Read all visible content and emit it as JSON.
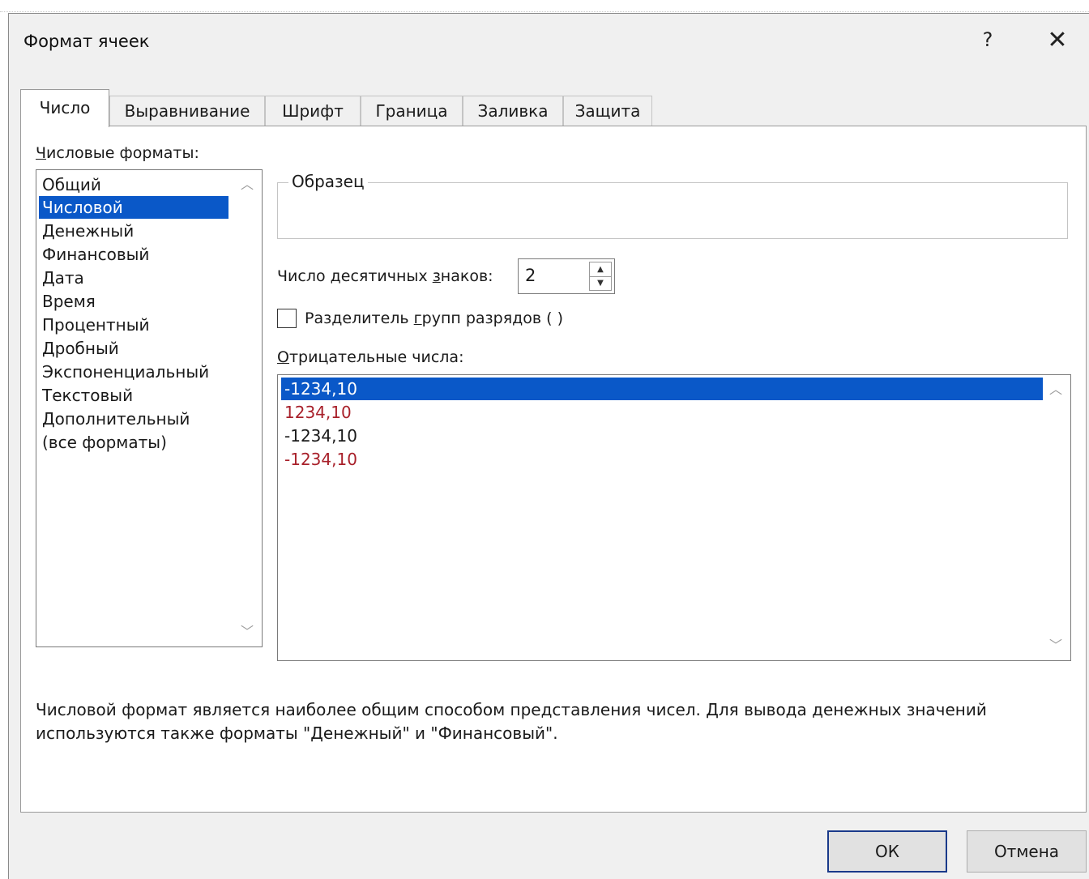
{
  "window": {
    "title": "Формат ячеек",
    "help_icon": "?",
    "close_icon": "✕"
  },
  "tabs": [
    {
      "label": "Число",
      "active": true
    },
    {
      "label": "Выравнивание",
      "active": false
    },
    {
      "label": "Шрифт",
      "active": false
    },
    {
      "label": "Граница",
      "active": false
    },
    {
      "label": "Заливка",
      "active": false
    },
    {
      "label": "Защита",
      "active": false
    }
  ],
  "category": {
    "label_ul": "Ч",
    "label_rest": "исловые форматы:",
    "items": [
      "Общий",
      "Числовой",
      "Денежный",
      "Финансовый",
      "Дата",
      "Время",
      "Процентный",
      "Дробный",
      "Экспоненциальный",
      "Текстовый",
      "Дополнительный",
      "(все форматы)"
    ],
    "selected": "Числовой"
  },
  "sample": {
    "label": "Образец",
    "value": ""
  },
  "decimals": {
    "label_pre": "Число десятичных ",
    "label_ul": "з",
    "label_post": "наков:",
    "value": "2"
  },
  "separator": {
    "label_pre": "Разделитель ",
    "label_ul": "г",
    "label_post": "рупп разрядов ( )",
    "checked": false
  },
  "negative": {
    "label_ul": "О",
    "label_rest": "трицательные числа:",
    "items": [
      {
        "text": "-1234,10",
        "color": "#000000",
        "selected": true
      },
      {
        "text": "1234,10",
        "color": "#a8202a",
        "selected": false
      },
      {
        "text": "-1234,10",
        "color": "#000000",
        "selected": false
      },
      {
        "text": "-1234,10",
        "color": "#a8202a",
        "selected": false
      }
    ]
  },
  "description": "Числовой формат является наиболее общим способом представления чисел. Для вывода денежных значений используются также форматы \"Денежный\" и \"Финансовый\".",
  "buttons": {
    "ok": "ОК",
    "cancel": "Отмена"
  },
  "colors": {
    "selection": "#0a58c8",
    "negative_red": "#a8202a",
    "dialog_bg": "#f0f0f0"
  }
}
